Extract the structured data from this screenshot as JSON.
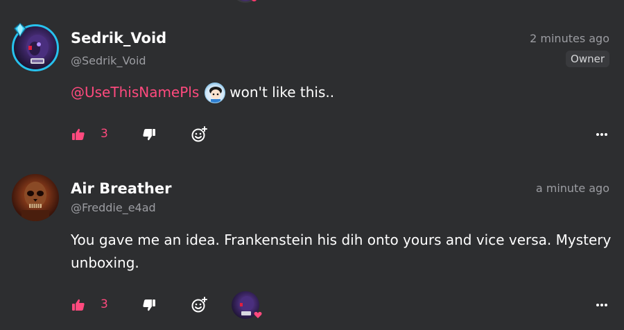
{
  "comments": [
    {
      "name": "Sedrik_Void",
      "handle": "@Sedrik_Void",
      "time": "2 minutes ago",
      "badge": "Owner",
      "mention": "@UseThisNamePls",
      "text": "won't like this..",
      "likes": "3",
      "avatar_icon": "purple-character-avatar",
      "accent_color": "#27c2ee"
    },
    {
      "name": "Air Breather",
      "handle": "@Freddie_e4ad",
      "time": "a minute ago",
      "text": "You gave me an idea. Frankenstein his dih onto yours and vice versa. Mystery unboxing.",
      "likes": "3",
      "avatar_icon": "skull-avatar"
    }
  ],
  "colors": {
    "background": "#2d2e30",
    "mention": "#ff4a7e",
    "like": "#ff4a7e",
    "muted": "#9c9da2"
  },
  "icons": {
    "like": "thumbs-up-icon",
    "dislike": "thumbs-down-icon",
    "react": "add-emoji-icon",
    "more": "more-options-icon"
  }
}
